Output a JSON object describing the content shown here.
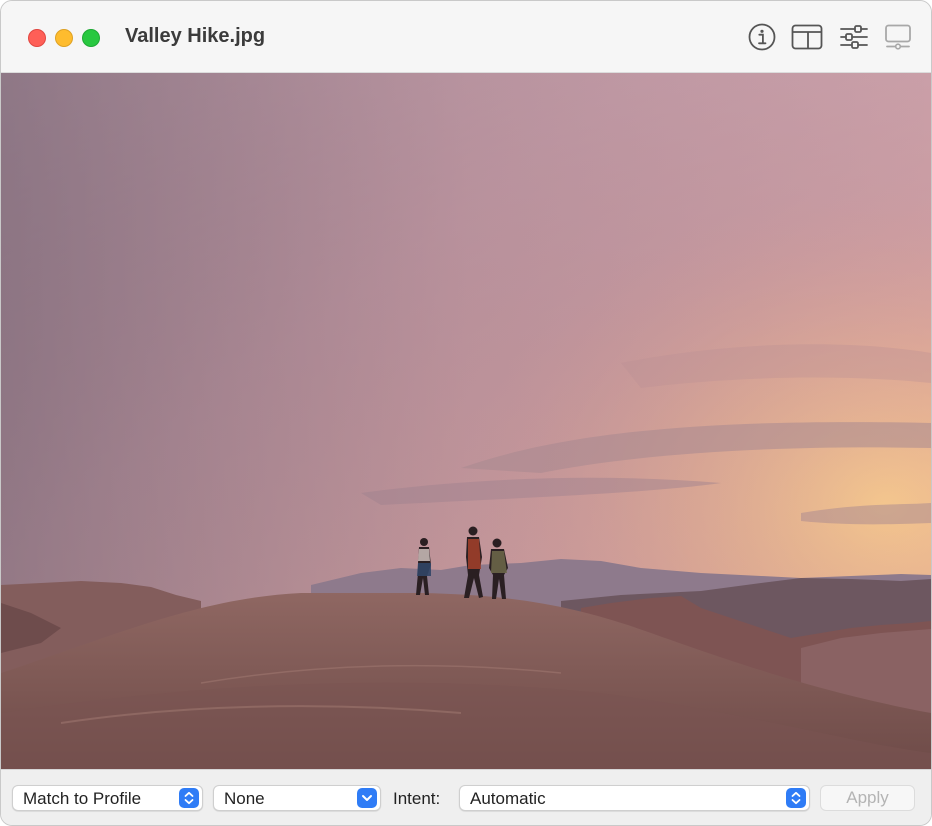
{
  "window": {
    "title": "Valley Hike.jpg"
  },
  "toolbar": {
    "icons": [
      "info-icon",
      "sidebar-icon",
      "adjust-icon",
      "slideshow-icon"
    ]
  },
  "bottom_bar": {
    "profile_popup": "Match to Profile",
    "profile_value_popup": "None",
    "intent_label": "Intent:",
    "intent_popup": "Automatic",
    "apply_button": "Apply"
  },
  "colors": {
    "accent": "#2f7cf6",
    "close": "#fe5f57",
    "minimize": "#febc2e",
    "maximize": "#28c840"
  }
}
